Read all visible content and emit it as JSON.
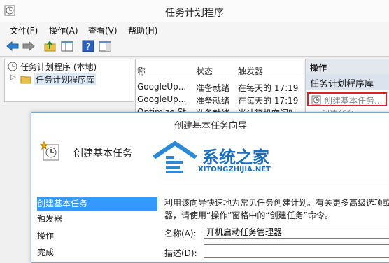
{
  "window": {
    "title": "任务计划程序"
  },
  "menu": [
    "文件(F)",
    "操作(A)",
    "查看(V)",
    "帮助(H)"
  ],
  "tree": {
    "root_label": "任务计划程序 (本地)",
    "child_label": "任务计划程序库"
  },
  "list": {
    "headers": [
      "称",
      "状态",
      "触发器"
    ],
    "rows": [
      [
        "GoogleUp...",
        "准备就绪",
        "在每天的 17:19"
      ],
      [
        "GoogleUp...",
        "准备就绪",
        "在每天的 17:19"
      ],
      [
        "Optimize St...",
        "准备就绪",
        "当计算机空闲时"
      ]
    ]
  },
  "actions": {
    "header": "操作",
    "section": "任务计划程序库",
    "item": "创建基本任务...",
    "item2": "创建任务..."
  },
  "wizard": {
    "title": "创建基本任务向导",
    "heading": "创建基本任务",
    "watermark": {
      "cn": "系统之家",
      "en": "XITONGZHIJIA.NET"
    },
    "steps": [
      "创建基本任务",
      "触发器",
      "操作",
      "完成"
    ],
    "description_line1": "利用该向导快速地为常见任务创建计划。有关更多高级选项或",
    "description_line2": "器，请使用“操作”窗格中的“创建任务”命令。",
    "name_label": "名称(A):",
    "name_value": "开机启动任务管理器",
    "desc_label": "描述(D):"
  },
  "colors": {
    "selection": "#3399ff",
    "highlight_border": "#e02020",
    "accent": "#1e73be"
  }
}
